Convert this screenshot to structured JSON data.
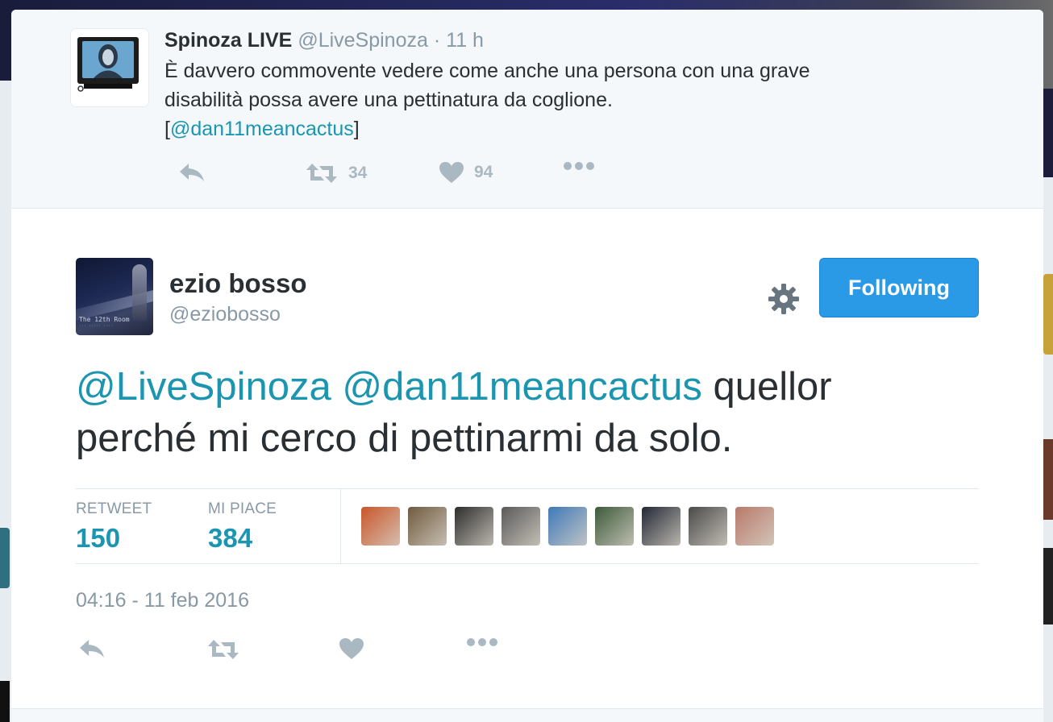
{
  "parent_tweet": {
    "name": "Spinoza LIVE",
    "handle": "@LiveSpinoza",
    "separator": "·",
    "time": "11 h",
    "text_line1": "È davvero commovente vedere come anche una persona con una grave",
    "text_line2": "disabilità possa avere una pettinatura da coglione.",
    "bracket_open": "[",
    "mention": "@dan11meancactus",
    "bracket_close": "]",
    "actions": {
      "reply_icon": "reply-icon",
      "retweet_icon": "retweet-icon",
      "retweet_count": "34",
      "like_icon": "heart-icon",
      "like_count": "94",
      "more_icon": "more-icon"
    }
  },
  "main_tweet": {
    "name": "ezio bosso",
    "handle": "@eziobosso",
    "avatar_caption": "The 12th Room",
    "gear_icon": "gear-icon",
    "follow_label": "Following",
    "mention1": "@LiveSpinoza",
    "mention2": "@dan11meancactus",
    "text_line1_rest": " quellor",
    "text_line2": "perché mi cerco di pettinarmi da solo.",
    "stats": {
      "retweet_label": "RETWEET",
      "retweet_count": "150",
      "like_label": "MI PIACE",
      "like_count": "384"
    },
    "likers": [
      {
        "color": "#c9562a"
      },
      {
        "color": "#6f5a3f"
      },
      {
        "color": "#2d2d2d"
      },
      {
        "color": "#5a5a5a"
      },
      {
        "color": "#3f79b8"
      },
      {
        "color": "#3d5a3a"
      },
      {
        "color": "#222833"
      },
      {
        "color": "#4a4a4a"
      },
      {
        "color": "#b87a6a"
      }
    ],
    "date": "04:16 - 11 feb 2016",
    "actions": {
      "reply_icon": "reply-icon",
      "retweet_icon": "retweet-icon",
      "like_icon": "heart-icon",
      "more_icon": "more-icon"
    }
  },
  "colors": {
    "link": "#1b95b0",
    "button": "#2b9ae6",
    "text": "#292f33",
    "muted": "#8899a6",
    "icon": "#aab8c2"
  }
}
